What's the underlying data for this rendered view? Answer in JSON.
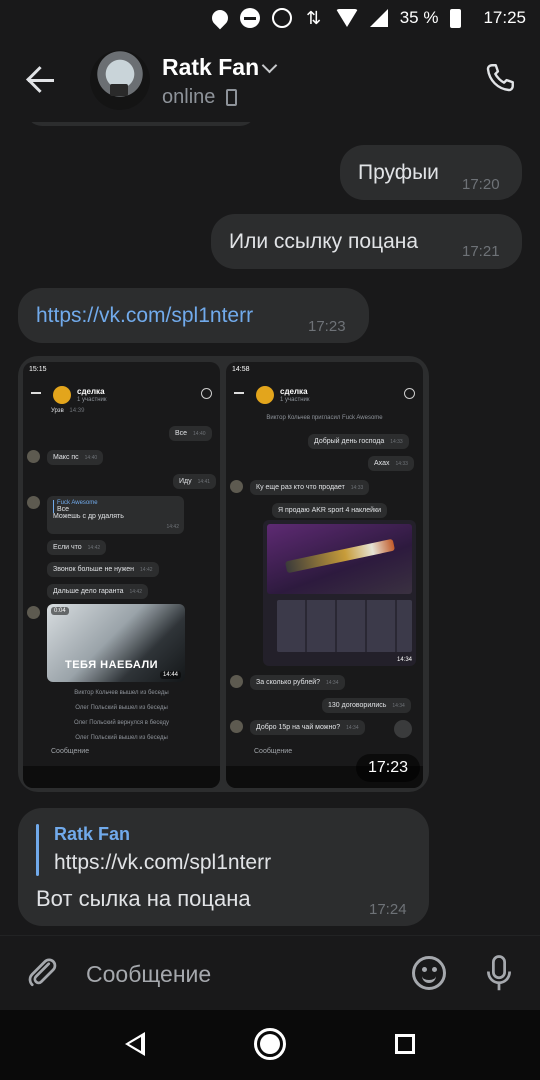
{
  "status_bar": {
    "battery": "35 %",
    "time": "17:25",
    "icons": [
      "location-icon",
      "dnd-icon",
      "alarm-icon",
      "data-icon",
      "wifi-icon",
      "signal-icon",
      "battery-icon"
    ]
  },
  "header": {
    "name": "Ratk Fan",
    "status": "online",
    "icons": [
      "back-arrow-icon",
      "chevron-down-icon",
      "phone-icon",
      "call-icon"
    ]
  },
  "messages": [
    {
      "text": "Пруфыи",
      "time": "17:20",
      "side": "out"
    },
    {
      "text": "Или ссылку поцана",
      "time": "17:21",
      "side": "out"
    },
    {
      "text": "https://vk.com/spl1nterr",
      "time": "17:23",
      "side": "in",
      "is_link": true
    }
  ],
  "photo_message": {
    "time": "17:23",
    "left_shot": {
      "status_time": "15:15",
      "chat_title": "сделка",
      "chat_sub": "1 участник",
      "bubbles": [
        "Все",
        "Макс пс",
        "Иду",
        "Если что",
        "Звонок больше не нужен",
        "Дальше дело гаранта"
      ],
      "bubble_times": [
        "14:40",
        "14:40",
        "14:41",
        "14:42",
        "14:42",
        "14:42"
      ],
      "top_cut": "Урзв",
      "top_cut_time": "14:39",
      "reply": {
        "author": "Fuck Awesome",
        "quoted": "Все",
        "text": "Можешь с др удалять",
        "time": "14:42"
      },
      "meme_caption": "ТЕБЯ НАЕБАЛИ",
      "meme_label": "0:04",
      "meme_time": "14:44",
      "system": [
        "Виктор Кольчев вышел из беседы",
        "Олег Польский вышел из беседы",
        "Олег Польский вернулся в беседу",
        "Олег Польский вышел из беседы"
      ],
      "input_placeholder": "Сообщение"
    },
    "right_shot": {
      "status_time": "14:58",
      "chat_title": "сделка",
      "chat_sub": "1 участник",
      "system": "Виктор Кольчев пригласил Fuck Awesome",
      "bubbles": [
        "Добрый день господа",
        "Ахах",
        "Ку еще раз кто что продает",
        "Я продаю AKR sport 4 наклейки",
        "За сколько рублей?",
        "130 договорились",
        "Добро 15р на чай можно?"
      ],
      "bubble_times": [
        "14:33",
        "14:33",
        "14:33",
        "",
        "14:34",
        "14:34",
        "14:34"
      ],
      "image_time": "14:34",
      "input_placeholder": "Сообщение"
    }
  },
  "forward_message": {
    "author": "Ratk Fan",
    "link": "https://vk.com/spl1nterr",
    "text": "Вот сылка на поцана",
    "time": "17:24"
  },
  "composer": {
    "placeholder": "Сообщение",
    "icons": [
      "attach-icon",
      "emoji-icon",
      "mic-icon"
    ]
  },
  "colors": {
    "background": "#19191a",
    "bubble": "#2c2d2e",
    "link": "#71aaeb",
    "text": "#e1e3e6",
    "muted": "#6e7277"
  }
}
